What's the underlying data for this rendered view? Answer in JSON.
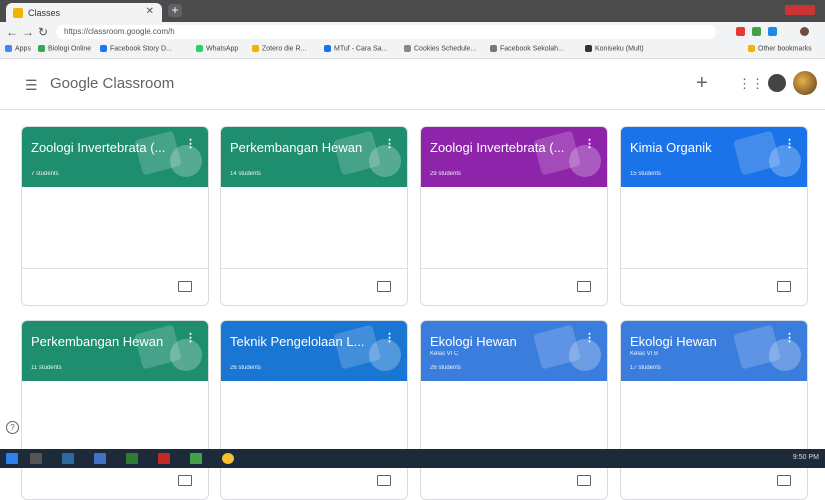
{
  "browser": {
    "tab_title": "Classes",
    "new_tab": "+",
    "url": "https://classroom.google.com/h",
    "bookmarks": [
      {
        "label": "Apps",
        "color": "#4285f4"
      },
      {
        "label": "Biologi Online",
        "color": "#34a853"
      },
      {
        "label": "Facebook Story D...",
        "color": "#1877f2"
      },
      {
        "label": "WhatsApp",
        "color": "#25d366"
      },
      {
        "label": "Zotero die R...",
        "color": "#f2b400"
      },
      {
        "label": "MTuf - Cara Sa...",
        "color": "#1a73e8"
      },
      {
        "label": "Cookies Schedule...",
        "color": "#888888"
      },
      {
        "label": "Facebook Sekolah...",
        "color": "#777777"
      },
      {
        "label": "Koniseku (Mult)",
        "color": "#333333"
      },
      {
        "label": "Other bookmarks",
        "color": "#f2b400"
      }
    ]
  },
  "header": {
    "menu_icon": "hamburger-menu-icon",
    "brand": "Google Classroom",
    "add_label": "+",
    "apps_icon": "apps-grid-icon",
    "account_icon": "account-circle-icon"
  },
  "cards": [
    {
      "title": "Zoologi Invertebrata (...",
      "section": "",
      "students": "7 students",
      "color": "#1e8e6e"
    },
    {
      "title": "Perkembangan Hewan",
      "section": "",
      "students": "14 students",
      "color": "#1e8e6e"
    },
    {
      "title": "Zoologi Invertebrata (...",
      "section": "",
      "students": "29 students",
      "color": "#8e24aa"
    },
    {
      "title": "Kimia Organik",
      "section": "",
      "students": "15 students",
      "color": "#1a73e8"
    },
    {
      "title": "Perkembangan Hewan",
      "section": "",
      "students": "11 students",
      "color": "#1e8e6e"
    },
    {
      "title": "Teknik Pengelolaan L...",
      "section": "",
      "students": "26 students",
      "color": "#1976d2"
    },
    {
      "title": "Ekologi Hewan",
      "section": "Kelas VI C",
      "students": "26 students",
      "color": "#3b7ddd"
    },
    {
      "title": "Ekologi Hewan",
      "section": "Kelas VI B",
      "students": "17 students",
      "color": "#3b7ddd"
    }
  ],
  "help_label": "?",
  "taskbar_time": "9:50 PM"
}
